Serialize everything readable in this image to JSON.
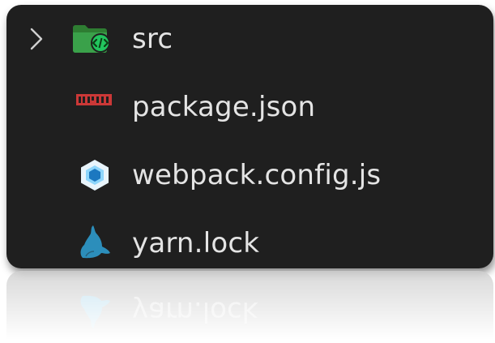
{
  "explorer": {
    "items": [
      {
        "label": "src",
        "icon": "folder-src-icon",
        "expandable": true,
        "expanded": false,
        "icon_color": "#3aa14a"
      },
      {
        "label": "package.json",
        "icon": "npm-icon",
        "icon_color": "#cb3837"
      },
      {
        "label": "webpack.config.js",
        "icon": "webpack-icon",
        "icon_color": "#8ed6fb"
      },
      {
        "label": "yarn.lock",
        "icon": "yarn-icon",
        "icon_color": "#2c8ebb"
      }
    ]
  },
  "reflection": {
    "label": "yarn.lock",
    "icon": "yarn-icon"
  },
  "colors": {
    "panel_bg": "#1f1f1f",
    "text": "#e4e4e4"
  }
}
